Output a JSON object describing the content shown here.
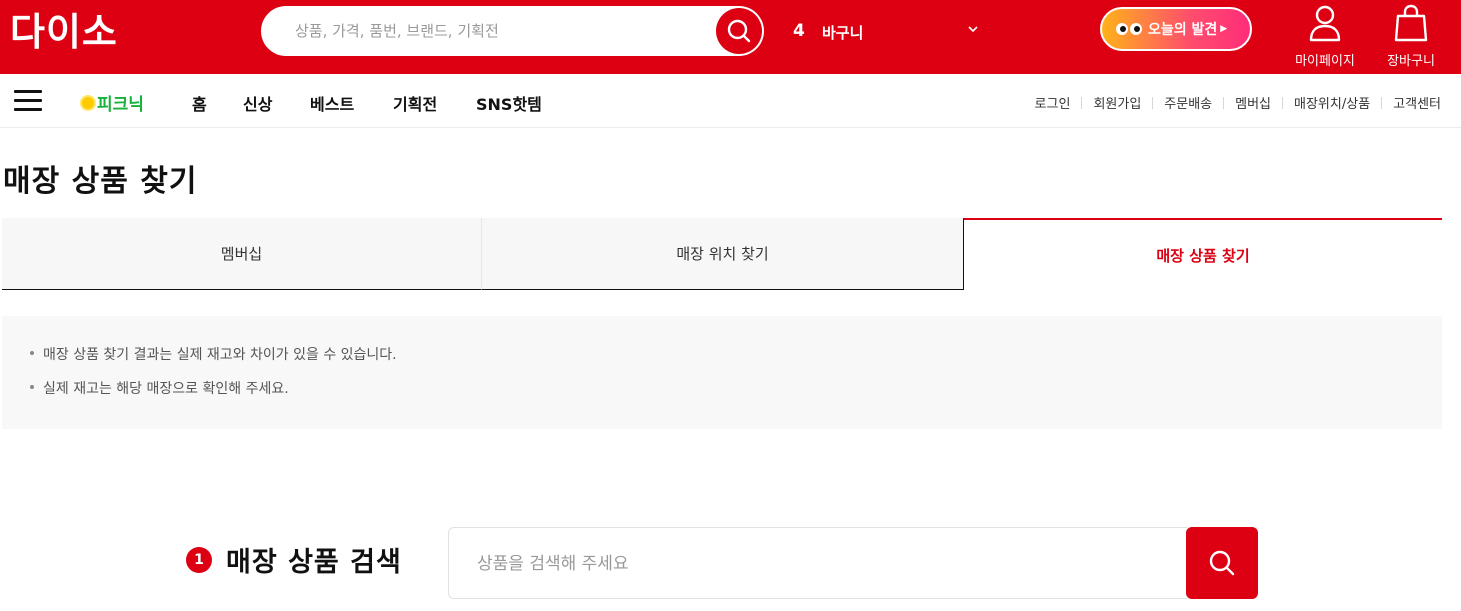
{
  "header": {
    "logo": "다이소",
    "search_placeholder": "상품, 가격, 품번, 브랜드, 기획전",
    "cart_count": "4",
    "cart_label": "바구니",
    "today_label": "오늘의 발견",
    "mypage_label": "마이페이지",
    "bag_label": "장바구니"
  },
  "nav": {
    "picnic": "피크닉",
    "items": [
      "홈",
      "신상",
      "베스트",
      "기획전",
      "SNS핫템"
    ],
    "utility": [
      "로그인",
      "회원가입",
      "주문배송",
      "멤버십",
      "매장위치/상품",
      "고객센터"
    ]
  },
  "page": {
    "title": "매장 상품 찾기",
    "tabs": [
      "멤버십",
      "매장 위치 찾기",
      "매장 상품 찾기"
    ],
    "active_tab": "매장 상품 찾기",
    "notices": [
      "매장 상품 찾기 결과는 실제 재고와 차이가 있을 수 있습니다.",
      "실제 재고는 해당 매장으로 확인해 주세요."
    ],
    "search_step_number": "1",
    "search_step_label": "매장 상품 검색",
    "product_search_placeholder": "상품을 검색해 주세요"
  },
  "colors": {
    "brand_red": "#dc0012",
    "picnic_green": "#18b23a"
  },
  "icons": [
    "search-icon",
    "chevron-down-icon",
    "user-icon",
    "shopping-bag-icon",
    "hamburger-menu-icon",
    "sun-icon"
  ]
}
